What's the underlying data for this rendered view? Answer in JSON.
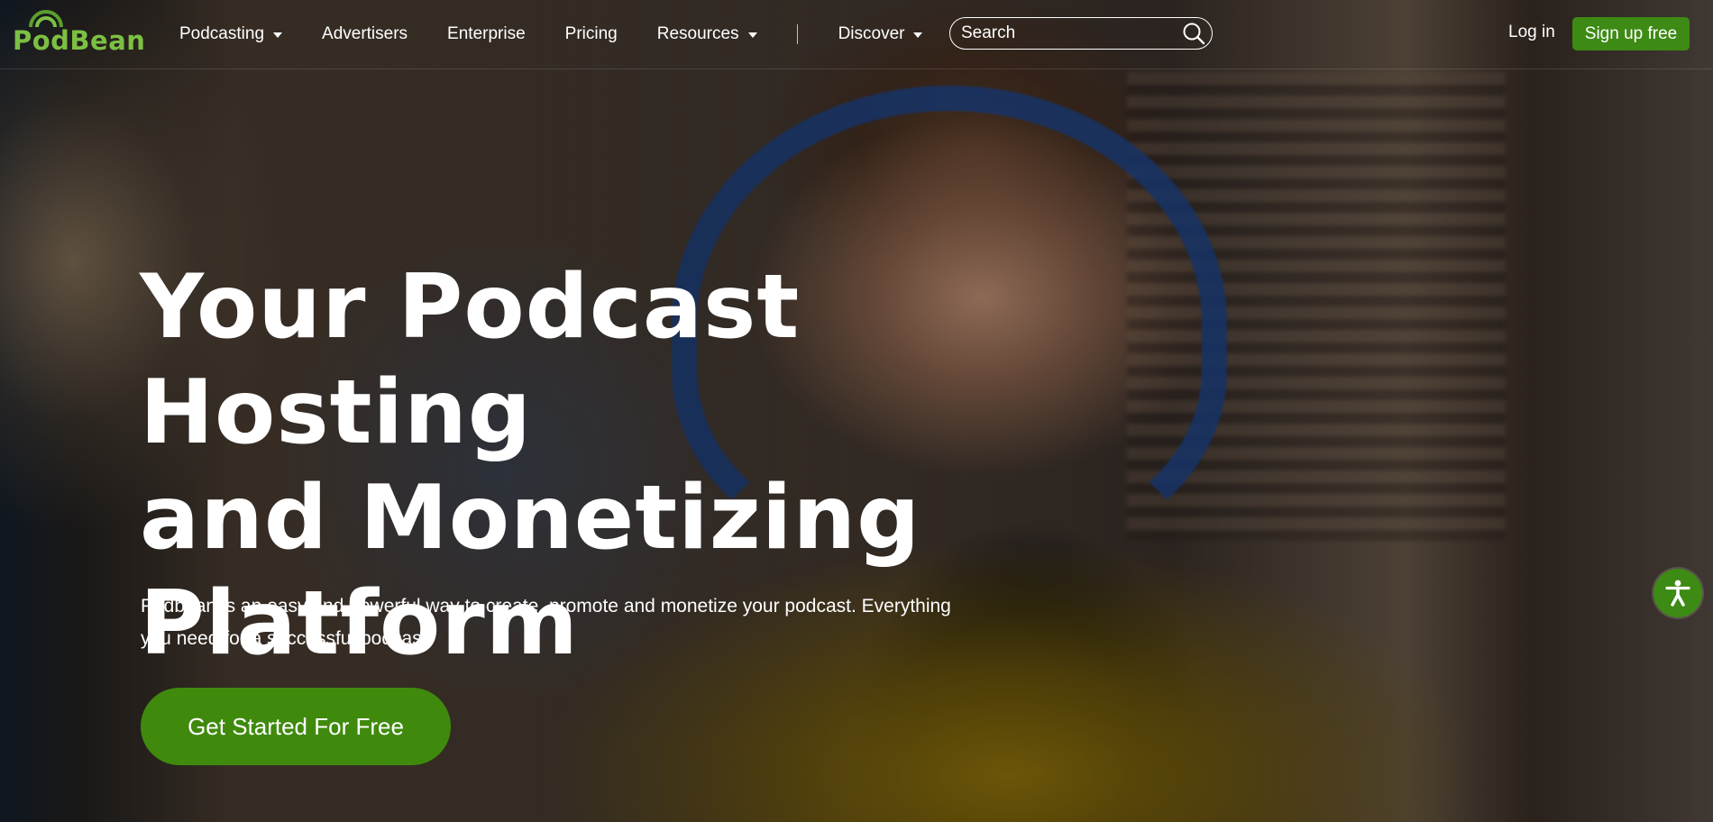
{
  "brand": {
    "logo_text": "PodBean",
    "logo_color": "#7bc043",
    "accent": "#3d8a14"
  },
  "header": {
    "nav": [
      {
        "label": "Podcasting",
        "has_dropdown": true
      },
      {
        "label": "Advertisers",
        "has_dropdown": false
      },
      {
        "label": "Enterprise",
        "has_dropdown": false
      },
      {
        "label": "Pricing",
        "has_dropdown": false
      },
      {
        "label": "Resources",
        "has_dropdown": true
      },
      {
        "label": "Discover",
        "has_dropdown": true
      }
    ],
    "search": {
      "placeholder": "Search",
      "value": "",
      "icon": "search-icon"
    },
    "login_label": "Log in",
    "signup_label": "Sign up free"
  },
  "hero": {
    "title_lines": [
      "Your Podcast Hosting",
      "and Monetizing",
      "Platform"
    ],
    "subtitle": "Podbean is an easy and powerful way to create, promote and monetize your podcast. Everything you need for a successful podcast.",
    "cta_label": "Get Started For Free"
  },
  "accessibility": {
    "icon": "accessibility-icon"
  }
}
